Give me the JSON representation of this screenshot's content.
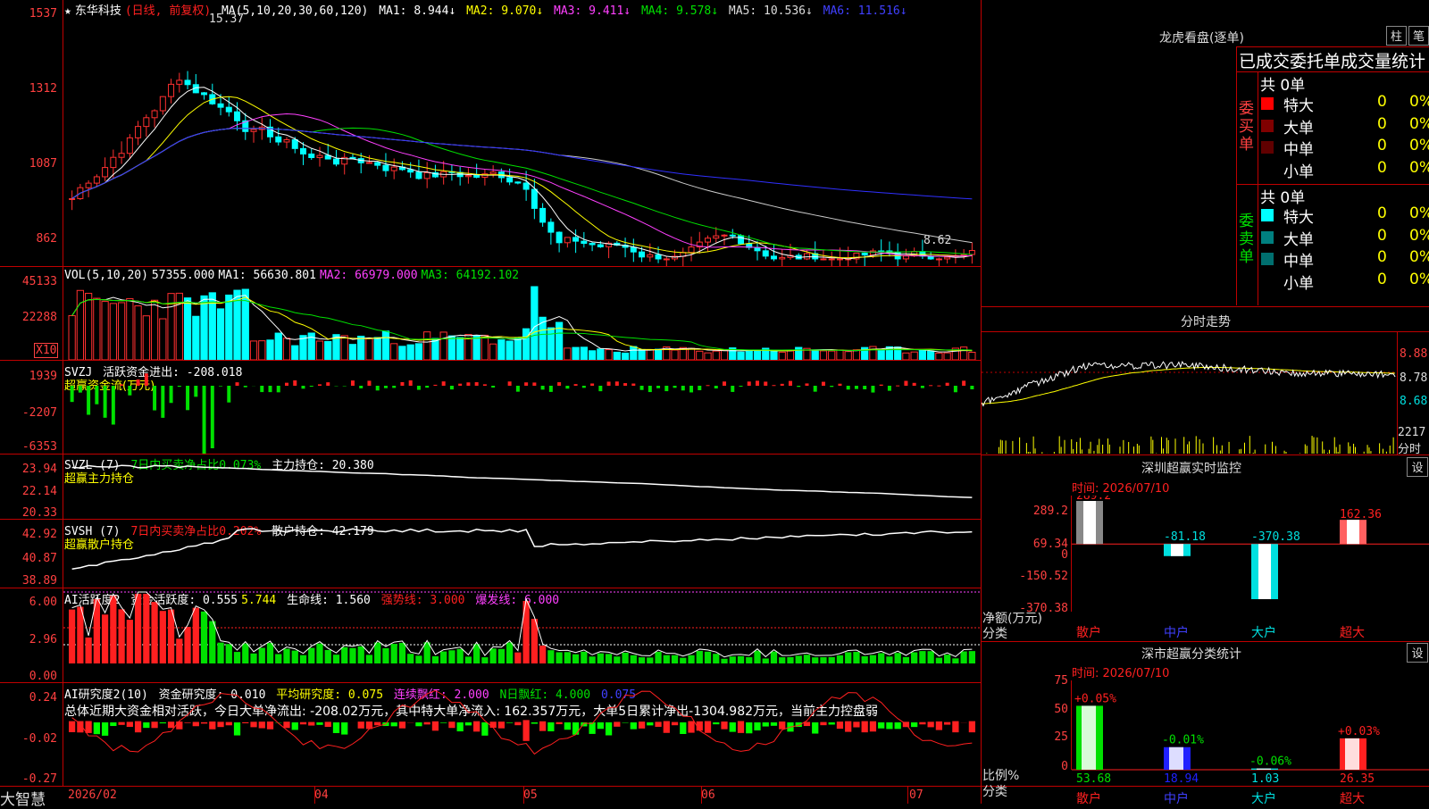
{
  "stock": {
    "name": "东华科技",
    "period": "(日线, 前复权)"
  },
  "main": {
    "ma_header": {
      "name": "MA(5,10,20,30,60,120)",
      "ma1": "MA1: 8.944",
      "ma2": "MA2: 9.070",
      "ma3": "MA3: 9.411",
      "ma4": "MA4: 9.578",
      "ma5": "MA5: 10.536",
      "ma6": "MA6: 11.516"
    },
    "arrow": "↓",
    "y_labels": [
      "1537",
      "1312",
      "1087",
      "862"
    ],
    "high_label": "15.37",
    "low_label": "8.62"
  },
  "vol": {
    "name": "VOL(5,10,20)",
    "value": "57355.000",
    "ma1": "MA1: 56630.801",
    "ma2": "MA2: 66979.000",
    "ma3": "MA3: 64192.102",
    "y_labels": [
      "45133",
      "22288"
    ],
    "unit": "X10"
  },
  "svzj": {
    "name": "SVZJ",
    "desc": "活跃资金进出: -208.018",
    "sub": "超赢资金流(万元)",
    "y_labels": [
      "1939",
      "-2207",
      "-6353"
    ]
  },
  "svzl": {
    "name": "SVZL (7)",
    "desc": "7日内买卖净占比0.073%",
    "hold": "主力持仓: 20.380",
    "sub": "超赢主力持仓",
    "y_labels": [
      "23.94",
      "22.14",
      "20.33"
    ]
  },
  "svsh": {
    "name": "SVSH (7)",
    "desc": "7日内买卖净占比0.202%",
    "hold": "散户持仓: 42.179",
    "sub": "超赢散户持仓",
    "y_labels": [
      "42.92",
      "40.87",
      "38.89"
    ]
  },
  "ai1": {
    "name": "AI活跃度2",
    "a": "资金活跃度: 0.555",
    "b": "5.744",
    "c": "生命线: 1.560",
    "d": "强势线: 3.000",
    "e": "爆发线: 6.000",
    "y_labels": [
      "6.00",
      "2.96",
      "0.00"
    ]
  },
  "ai2": {
    "name": "AI研究度2(10)",
    "a": "资金研究度: 0.010",
    "b": "平均研究度: 0.075",
    "c": "连续飘红: 2.000",
    "d": "N日飘红: 4.000",
    "e": "0.075",
    "summary": "总体近期大资金相对活跃，今日大单净流出: -208.02万元，其中特大单净流入: 162.357万元，大单5日累计净出-1304.982万元，当前主力控盘弱",
    "y_labels": [
      "0.24",
      "-0.02",
      "-0.27"
    ]
  },
  "xaxis": [
    "2026/02",
    "04",
    "05",
    "06",
    "07"
  ],
  "brand": "大智慧",
  "lhb": {
    "title": "龙虎看盘(逐单)",
    "btn1": "柱",
    "btn2": "笔",
    "header": "已成交委托单成交量统计",
    "buy": {
      "label": "委买单",
      "total": "共 0单",
      "rows": [
        {
          "name": "特大",
          "v": "0",
          "p": "0%",
          "c": "#ff0000"
        },
        {
          "name": "大单",
          "v": "0",
          "p": "0%",
          "c": "#800000"
        },
        {
          "name": "中单",
          "v": "0",
          "p": "0%",
          "c": "#600000"
        },
        {
          "name": "小单",
          "v": "0",
          "p": "0%",
          "c": "#000000"
        }
      ]
    },
    "sell": {
      "label": "委卖单",
      "total": "共 0单",
      "rows": [
        {
          "name": "特大",
          "v": "0",
          "p": "0%",
          "c": "#00ffff"
        },
        {
          "name": "大单",
          "v": "0",
          "p": "0%",
          "c": "#008080"
        },
        {
          "name": "中单",
          "v": "0",
          "p": "0%",
          "c": "#006f6f"
        },
        {
          "name": "小单",
          "v": "0",
          "p": "0%",
          "c": "#000000"
        }
      ]
    }
  },
  "intraday": {
    "title": "分时走势",
    "y_labels": [
      "8.88",
      "8.78",
      "8.68"
    ],
    "vol_label": "2217",
    "unit": "分时"
  },
  "monitor": {
    "title": "深圳超赢实时监控",
    "btn": "设",
    "time": "时间: 2026/07/10",
    "y_labels": [
      "289.2",
      "69.34",
      "0",
      "-150.52",
      "-370.38"
    ],
    "values": [
      "289.2",
      "-81.18",
      "-370.38",
      "162.36"
    ],
    "cats": [
      "散户",
      "中户",
      "大户",
      "超大"
    ],
    "axis1": "净额(万元)",
    "axis2": "分类"
  },
  "classify": {
    "title": "深市超赢分类统计",
    "btn": "设",
    "time": "时间: 2026/07/10",
    "y_labels": [
      "75",
      "50",
      "25",
      "0"
    ],
    "pct": [
      "+0.05%",
      "-0.01%",
      "-0.06%",
      "+0.03%"
    ],
    "values": [
      "53.68",
      "18.94",
      "1.03",
      "26.35"
    ],
    "cats": [
      "散户",
      "中户",
      "大户",
      "超大"
    ],
    "axis1": "比例%",
    "axis2": "分类"
  }
}
